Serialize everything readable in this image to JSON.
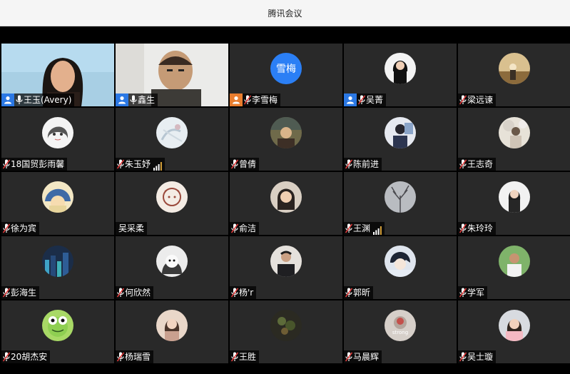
{
  "window": {
    "title": "腾讯会议"
  },
  "participants": [
    {
      "name": "王玉(Avery)",
      "avatar": "video-woman",
      "role": "host",
      "mic": "on"
    },
    {
      "name": "鑫生",
      "avatar": "video-man",
      "role": "host",
      "mic": "on",
      "speaking": true
    },
    {
      "name": "李雪梅",
      "avatar": "text",
      "avatar_text": "雪梅",
      "role": "cohost",
      "mic": "off"
    },
    {
      "name": "吴菁",
      "avatar": "photo-woman-dark",
      "role": "host",
      "mic": "off"
    },
    {
      "name": "梁远谏",
      "avatar": "photo-warm-street",
      "mic": "off"
    },
    {
      "name": "18国贸彭雨馨",
      "avatar": "cartoon-girl",
      "mic": "off"
    },
    {
      "name": "朱玉妤",
      "avatar": "illustration-light",
      "mic": "off",
      "signal": true
    },
    {
      "name": "曾倩",
      "avatar": "photo-cafe",
      "mic": "off"
    },
    {
      "name": "陈前进",
      "avatar": "photo-student",
      "mic": "off"
    },
    {
      "name": "王志奇",
      "avatar": "photo-blossom",
      "mic": "off"
    },
    {
      "name": "徐为宾",
      "avatar": "cartoon-blue",
      "mic": "off"
    },
    {
      "name": "吴采柔",
      "avatar": "illustration-sketch",
      "mic": "none"
    },
    {
      "name": "俞洁",
      "avatar": "photo-girl",
      "mic": "off"
    },
    {
      "name": "王渊",
      "avatar": "photo-branches",
      "mic": "off",
      "signal": true
    },
    {
      "name": "朱玲玲",
      "avatar": "photo-woman-white",
      "mic": "off"
    },
    {
      "name": "彭海生",
      "avatar": "photo-city-night",
      "mic": "off"
    },
    {
      "name": "何欣然",
      "avatar": "photo-bw-cat",
      "mic": "off"
    },
    {
      "name": "杨'r",
      "avatar": "photo-man-suit",
      "mic": "off"
    },
    {
      "name": "郭昕",
      "avatar": "anime-boy",
      "mic": "off"
    },
    {
      "name": "学军",
      "avatar": "photo-man-outdoor",
      "mic": "off"
    },
    {
      "name": "20胡杰安",
      "avatar": "cartoon-frog",
      "mic": "off"
    },
    {
      "name": "杨瑞雪",
      "avatar": "photo-woman-pink",
      "mic": "off"
    },
    {
      "name": "王胜",
      "avatar": "photo-dark-plant",
      "mic": "off"
    },
    {
      "name": "马晨辉",
      "avatar": "photo-strong",
      "avatar_text": "strong",
      "mic": "off"
    },
    {
      "name": "吴士璇",
      "avatar": "photo-woman-car",
      "mic": "off"
    }
  ],
  "colors": {
    "tile_bg": "#292929",
    "host_badge": "#2b78e4",
    "cohost_badge": "#e87d2e",
    "avatar_text_bg": "#2b7ff5",
    "active_border": "#3a8e3a"
  }
}
